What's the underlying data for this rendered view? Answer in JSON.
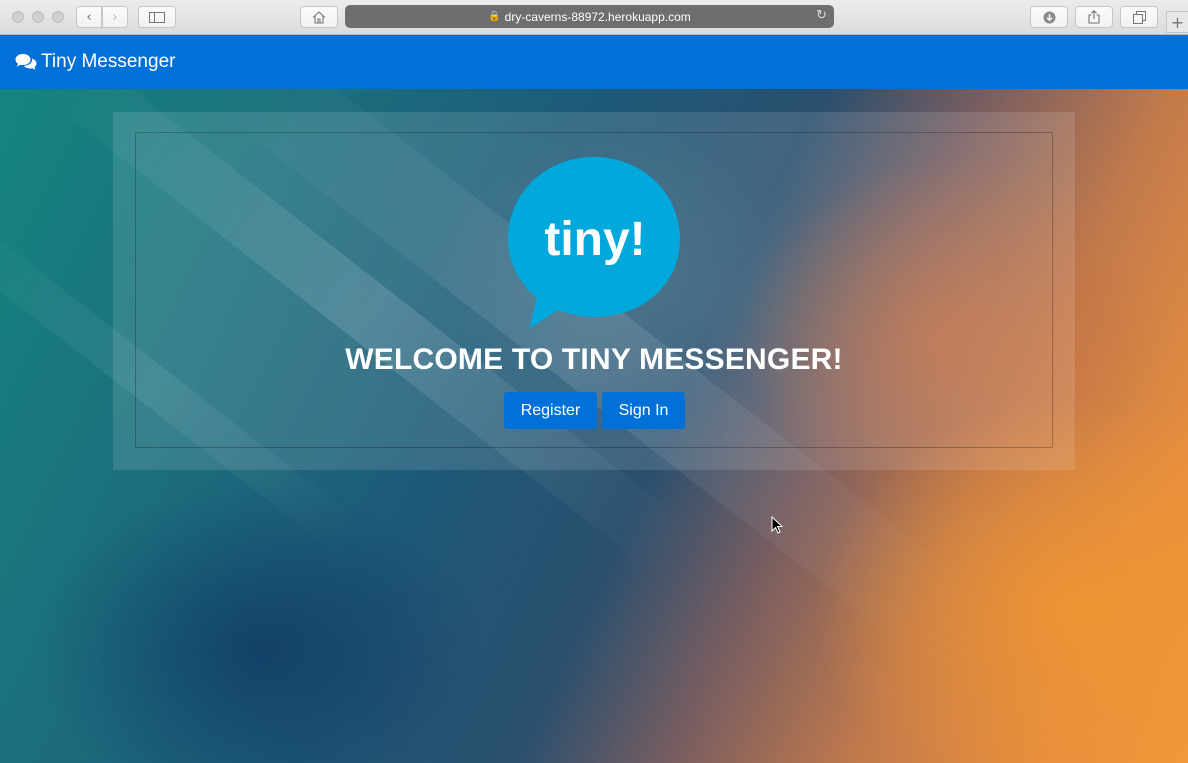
{
  "browser": {
    "url": "dry-caverns-88972.herokuapp.com",
    "icons": {
      "back": "chevron-left-icon",
      "forward": "chevron-right-icon",
      "sidebar": "sidebar-icon",
      "home": "home-icon",
      "lock": "lock-icon",
      "reload": "reload-icon",
      "download": "download-icon",
      "share": "share-icon",
      "tabs": "tabs-icon",
      "new_tab": "plus-icon"
    }
  },
  "navbar": {
    "brand": "Tiny Messenger",
    "brand_icon": "comments-icon",
    "color": "#0271d7"
  },
  "hero": {
    "logo_text": "tiny!",
    "logo_color": "#00a8dc",
    "title": "WELCOME TO TINY MESSENGER!",
    "buttons": {
      "register": "Register",
      "sign_in": "Sign In"
    },
    "button_color": "#0271d7"
  }
}
